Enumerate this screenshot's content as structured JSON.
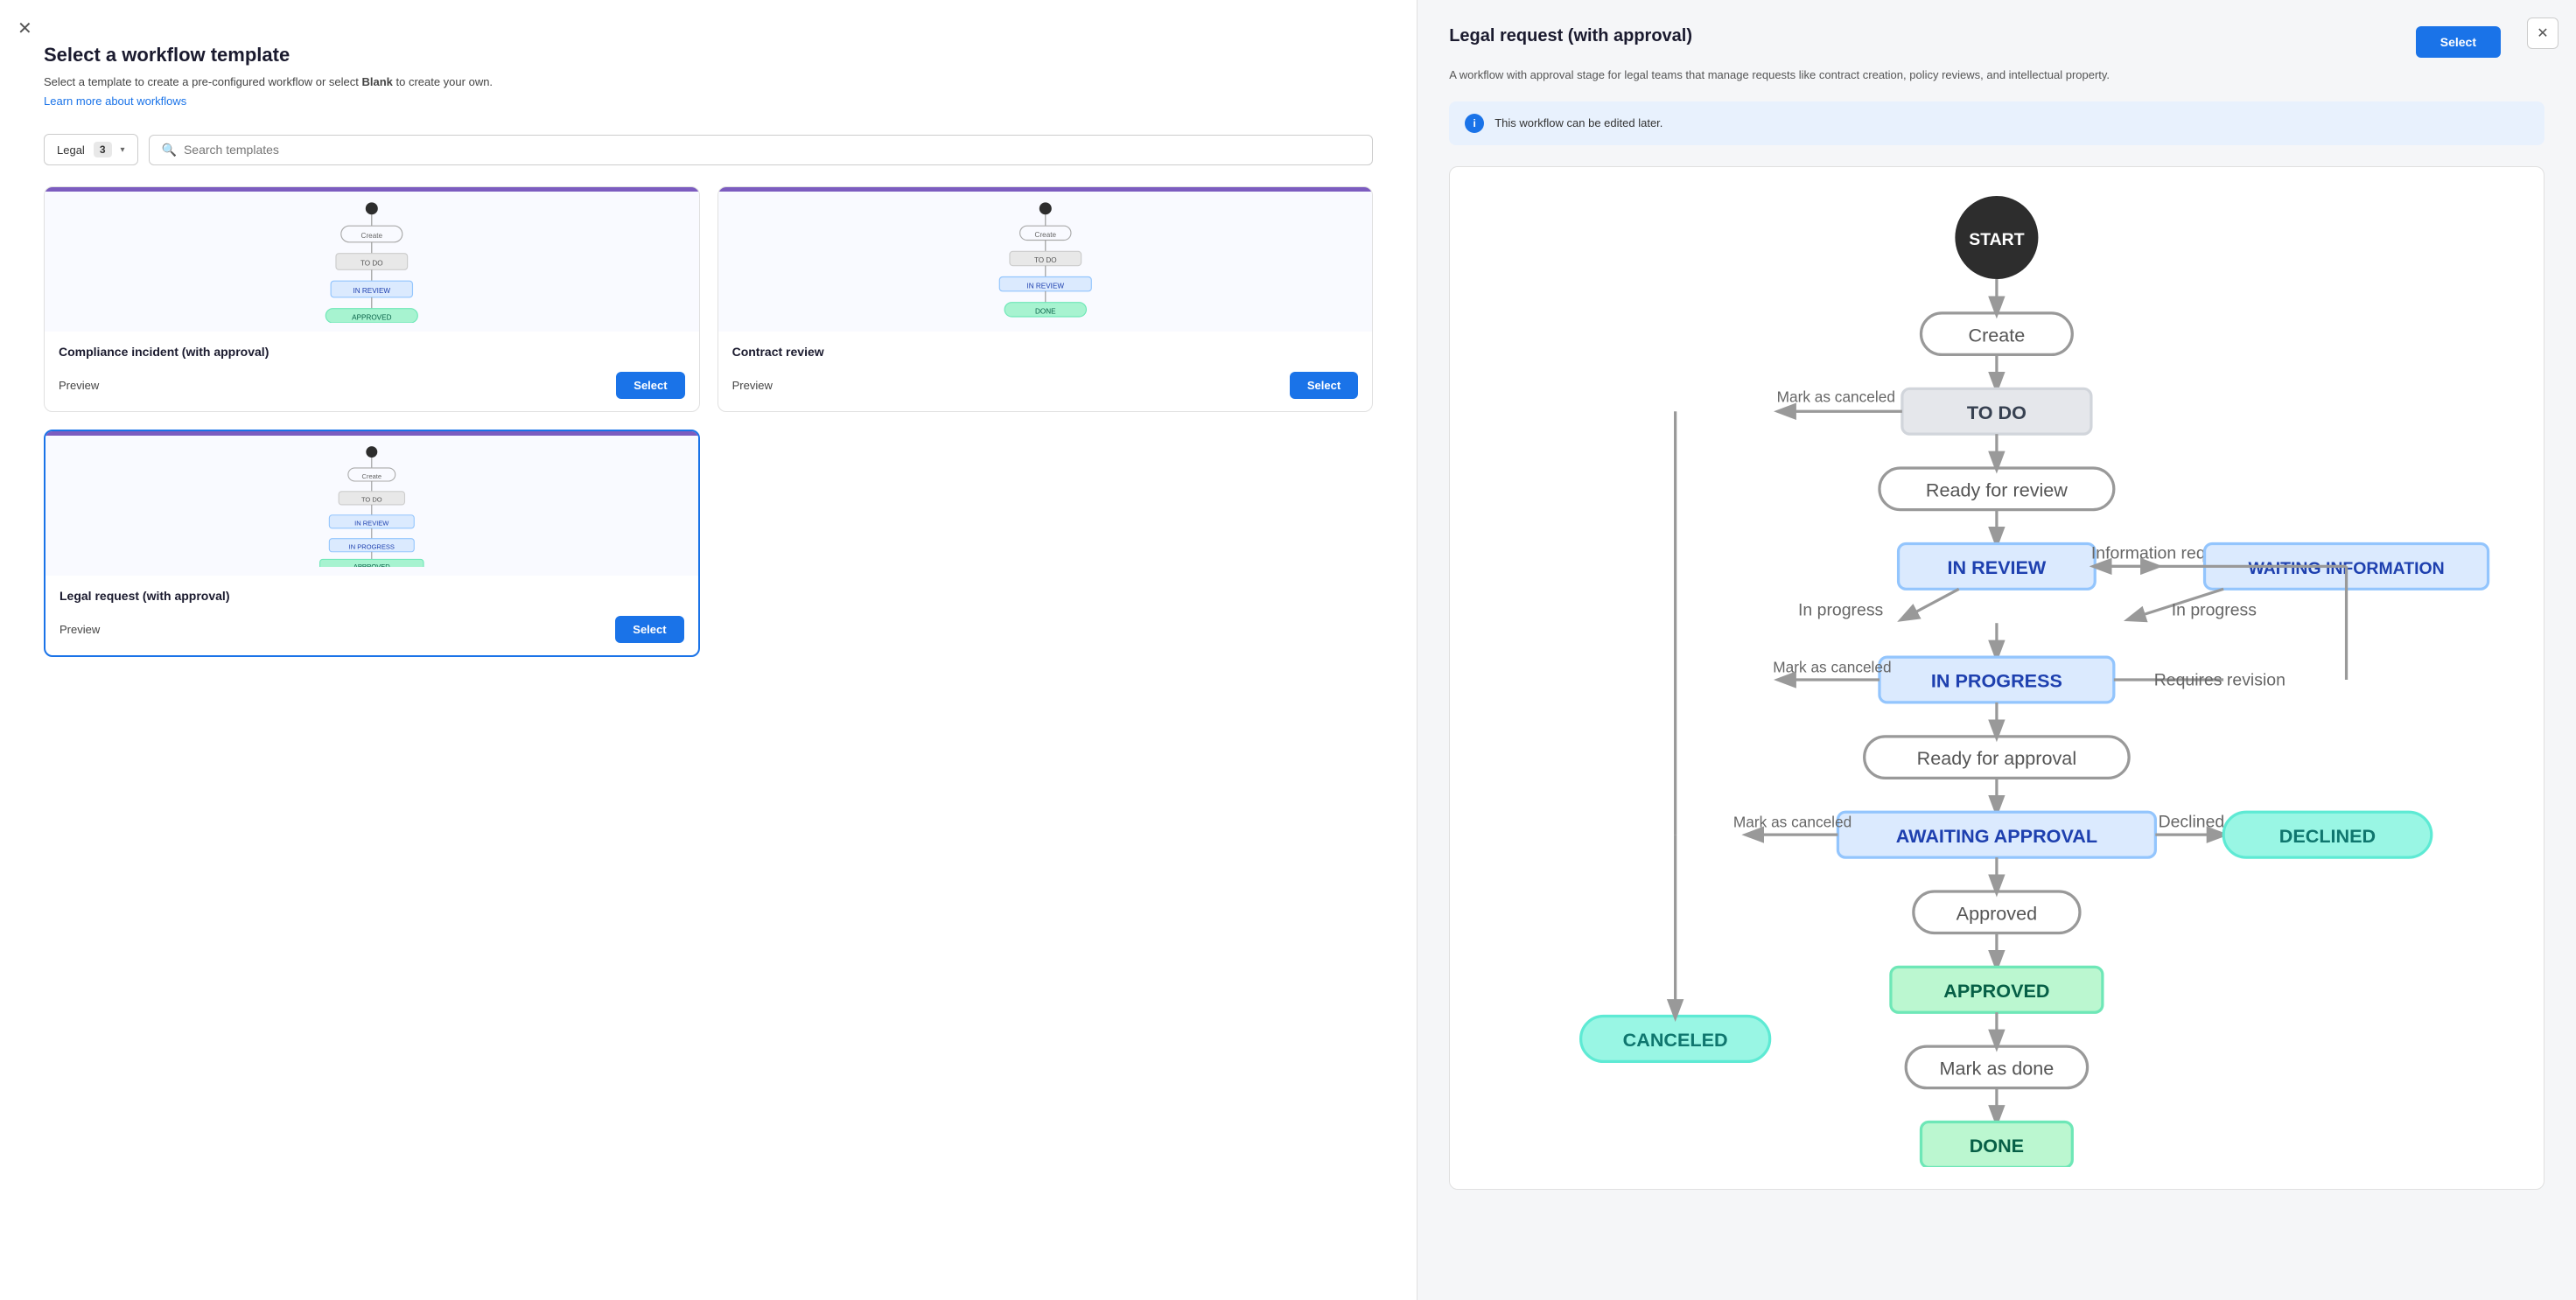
{
  "leftPanel": {
    "closeAriaLabel": "Close",
    "pageTitle": "Select a workflow template",
    "subtitle": "Select a template to create a pre-configured workflow or select ",
    "subtitleBold": "Blank",
    "subtitleEnd": " to create your own.",
    "learnMoreText": "Learn more about workflows",
    "filterLabel": "Legal",
    "filterCount": "3",
    "searchPlaceholder": "Search templates",
    "templates": [
      {
        "id": "compliance",
        "name": "Compliance incident (with approval)",
        "selected": false
      },
      {
        "id": "contract",
        "name": "Contract review",
        "selected": false
      },
      {
        "id": "legal",
        "name": "Legal request (with approval)",
        "selected": true
      }
    ],
    "previewLabel": "Preview",
    "selectLabel": "Select"
  },
  "rightPanel": {
    "closeAriaLabel": "Close preview",
    "title": "Legal request (with approval)",
    "description": "A workflow with approval stage for legal teams that manage requests like contract creation, policy reviews, and intellectual property.",
    "selectLabel": "Select",
    "infoBannerText": "This workflow can be edited later.",
    "diagram": {
      "nodes": [
        {
          "id": "start",
          "label": "START",
          "type": "start"
        },
        {
          "id": "create",
          "label": "Create",
          "type": "action"
        },
        {
          "id": "todo",
          "label": "TO DO",
          "type": "state-gray"
        },
        {
          "id": "readyForReview",
          "label": "Ready for review",
          "type": "action"
        },
        {
          "id": "inReview",
          "label": "IN REVIEW",
          "type": "state-blue"
        },
        {
          "id": "infoRequired",
          "label": "Information required",
          "type": "action"
        },
        {
          "id": "waitingInfo",
          "label": "WAITING INFORMATION",
          "type": "state-blue"
        },
        {
          "id": "inProgress1",
          "label": "In progress",
          "type": "action"
        },
        {
          "id": "inProgress2",
          "label": "In progress",
          "type": "action"
        },
        {
          "id": "inProgress",
          "label": "IN PROGRESS",
          "type": "state-blue"
        },
        {
          "id": "requiresRevision",
          "label": "Requires revision",
          "type": "action"
        },
        {
          "id": "readyForApproval",
          "label": "Ready for approval",
          "type": "action"
        },
        {
          "id": "awaitingApproval",
          "label": "AWAITING APPROVAL",
          "type": "state-blue"
        },
        {
          "id": "declined1",
          "label": "Declined",
          "type": "action"
        },
        {
          "id": "declined",
          "label": "DECLINED",
          "type": "state-teal"
        },
        {
          "id": "approved1",
          "label": "Approved",
          "type": "action"
        },
        {
          "id": "approved",
          "label": "APPROVED",
          "type": "state-green"
        },
        {
          "id": "markAsDone",
          "label": "Mark as done",
          "type": "action"
        },
        {
          "id": "done",
          "label": "DONE",
          "type": "state-green"
        },
        {
          "id": "canceled",
          "label": "CANCELED",
          "type": "state-teal"
        },
        {
          "id": "markCanceled1",
          "label": "Mark as canceled",
          "type": "action"
        },
        {
          "id": "markCanceled2",
          "label": "Mark as canceled",
          "type": "action"
        },
        {
          "id": "markCanceled3",
          "label": "Mark as canceled",
          "type": "action"
        }
      ]
    }
  }
}
